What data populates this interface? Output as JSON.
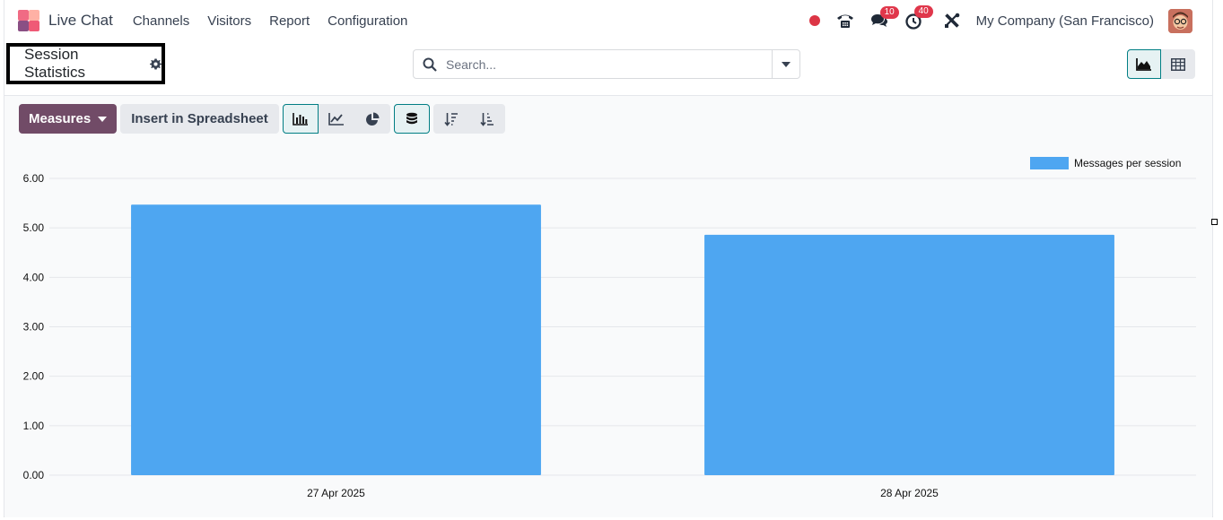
{
  "navbar": {
    "app_name": "Live Chat",
    "menu": [
      "Channels",
      "Visitors",
      "Report",
      "Configuration"
    ],
    "messages_badge": "10",
    "activities_badge": "40",
    "company": "My Company (San Francisco)"
  },
  "control_panel": {
    "title": "Session Statistics",
    "search_placeholder": "Search..."
  },
  "toolbar": {
    "measures_label": "Measures",
    "spreadsheet_label": "Insert in Spreadsheet"
  },
  "colors": {
    "brand": "#714b67",
    "accent": "#017e84",
    "bar": "#4ea6f1",
    "badge": "#e0374b"
  },
  "chart_data": {
    "type": "bar",
    "categories": [
      "27 Apr 2025",
      "28 Apr 2025"
    ],
    "series": [
      {
        "name": "Messages per session",
        "values": [
          5.47,
          4.86
        ]
      }
    ],
    "yticks": [
      "0.00",
      "1.00",
      "2.00",
      "3.00",
      "4.00",
      "5.00",
      "6.00"
    ],
    "ylim": [
      0,
      6
    ],
    "grid": true,
    "legend": "top-right"
  }
}
